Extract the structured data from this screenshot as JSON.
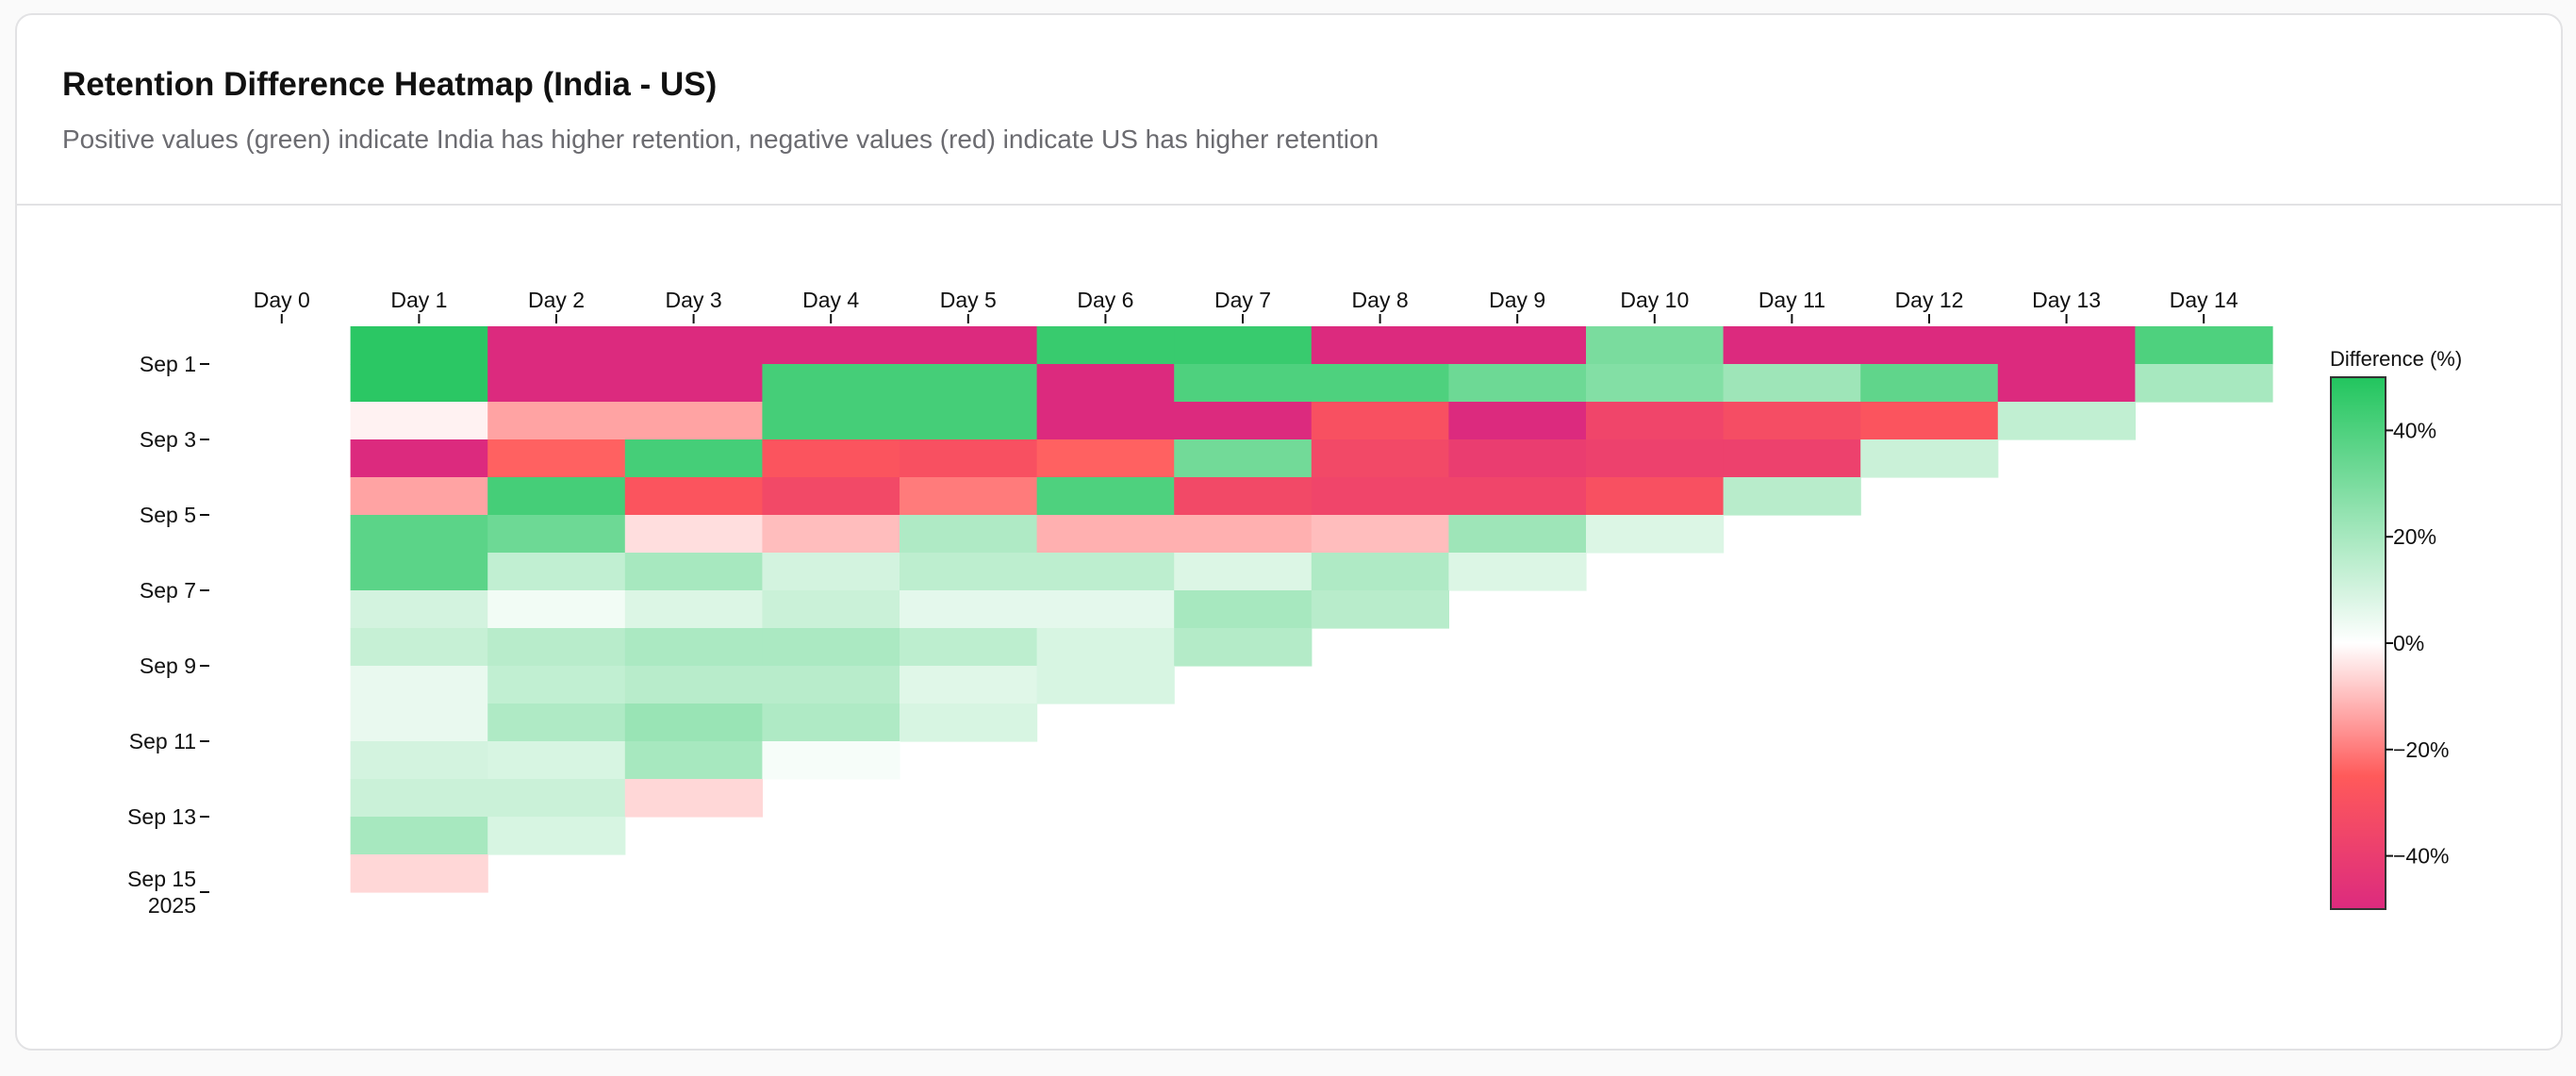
{
  "header": {
    "title": "Retention Difference Heatmap (India - US)",
    "subtitle": "Positive values (green) indicate India has higher retention, negative values (red) indicate US has higher retention"
  },
  "colors": {
    "strong_positive": "#22c55e",
    "neutral": "#ffffff",
    "mid_negative": "#ff5a5a",
    "strong_negative": "#dc2a7e"
  },
  "chart_data": {
    "type": "heatmap",
    "title": "Retention Difference Heatmap (India - US)",
    "subtitle": "Positive values (green) indicate India has higher retention, negative values (red) indicate US has higher retention",
    "x_categories": [
      "Day 0",
      "Day 1",
      "Day 2",
      "Day 3",
      "Day 4",
      "Day 5",
      "Day 6",
      "Day 7",
      "Day 8",
      "Day 9",
      "Day 10",
      "Day 11",
      "Day 12",
      "Day 13",
      "Day 14"
    ],
    "y_tick_labels": [
      "Sep 1",
      "Sep 3",
      "Sep 5",
      "Sep 7",
      "Sep 9",
      "Sep 11",
      "Sep 13",
      "Sep 15",
      "2025"
    ],
    "rows": [
      {
        "cohort": "2025-08-31",
        "values": [
          null,
          48,
          -55,
          -55,
          -55,
          -55,
          45,
          45,
          -55,
          -55,
          30,
          -55,
          -55,
          -55,
          40
        ]
      },
      {
        "cohort": "2025-09-01",
        "values": [
          null,
          48,
          -55,
          -55,
          42,
          42,
          -55,
          40,
          40,
          33,
          28,
          22,
          36,
          -55,
          20
        ]
      },
      {
        "cohort": "2025-09-02",
        "values": [
          null,
          -2,
          -14,
          -14,
          42,
          42,
          -55,
          -55,
          -30,
          -55,
          -36,
          -32,
          -28,
          14
        ]
      },
      {
        "cohort": "2025-09-03",
        "values": [
          null,
          -55,
          -24,
          42,
          -28,
          -30,
          -24,
          32,
          -34,
          -40,
          -38,
          -38,
          12
        ]
      },
      {
        "cohort": "2025-09-04",
        "values": [
          null,
          -14,
          42,
          -28,
          -34,
          -20,
          40,
          -34,
          -36,
          -36,
          -30,
          16
        ]
      },
      {
        "cohort": "2025-09-05",
        "values": [
          null,
          37,
          33,
          -5,
          -10,
          18,
          -12,
          -12,
          -10,
          22,
          8
        ]
      },
      {
        "cohort": "2025-09-06",
        "values": [
          null,
          37,
          14,
          20,
          10,
          15,
          15,
          8,
          18,
          8
        ]
      },
      {
        "cohort": "2025-09-07",
        "values": [
          null,
          10,
          3,
          8,
          12,
          6,
          6,
          20,
          16
        ]
      },
      {
        "cohort": "2025-09-08",
        "values": [
          null,
          13,
          16,
          19,
          19,
          15,
          9,
          17
        ]
      },
      {
        "cohort": "2025-09-09",
        "values": [
          null,
          5,
          14,
          16,
          16,
          7,
          9
        ]
      },
      {
        "cohort": "2025-09-10",
        "values": [
          null,
          5,
          18,
          23,
          18,
          9
        ]
      },
      {
        "cohort": "2025-09-11",
        "values": [
          null,
          10,
          9,
          20,
          2
        ]
      },
      {
        "cohort": "2025-09-12",
        "values": [
          null,
          12,
          12,
          -6
        ]
      },
      {
        "cohort": "2025-09-13",
        "values": [
          null,
          20,
          9
        ]
      },
      {
        "cohort": "2025-09-14",
        "values": [
          null,
          -6
        ]
      }
    ],
    "color_scale": {
      "domain": [
        -50,
        -25,
        0,
        50
      ],
      "colors": [
        "#dc2a7e",
        "#ff5a5a",
        "#ffffff",
        "#22c55e"
      ]
    },
    "legend": {
      "title": "Difference (%)",
      "ticks": [
        40,
        20,
        0,
        -20,
        -40
      ],
      "tick_labels": [
        "40%",
        "20%",
        "0%",
        "−20%",
        "−40%"
      ],
      "placement": "right",
      "range": [
        -50,
        50
      ]
    },
    "grid": false
  }
}
